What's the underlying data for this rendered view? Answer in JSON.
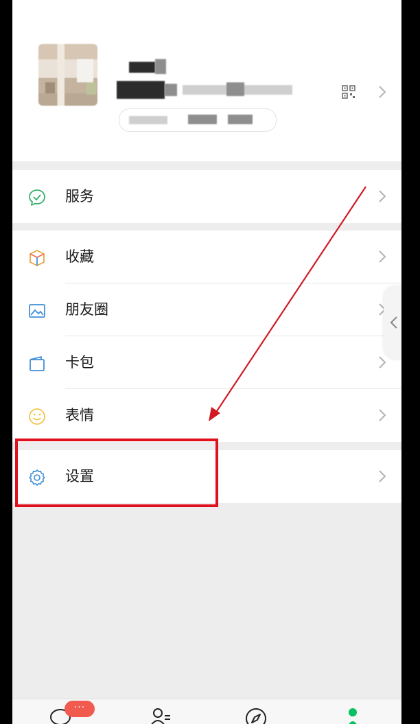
{
  "menu": {
    "service": "服务",
    "favorites": "收藏",
    "moments": "朋友圈",
    "cards": "卡包",
    "stickers": "表情",
    "settings": "设置"
  },
  "tabbar": {
    "chats_badge": "···"
  },
  "colors": {
    "highlight": "#e0101c",
    "badge": "#f05a4f",
    "wechat_green": "#07c160"
  },
  "icons": {
    "service": "service-check-icon",
    "favorites": "cube-icon",
    "moments": "image-icon",
    "cards": "wallet-icon",
    "stickers": "smiley-icon",
    "settings": "gear-icon"
  }
}
